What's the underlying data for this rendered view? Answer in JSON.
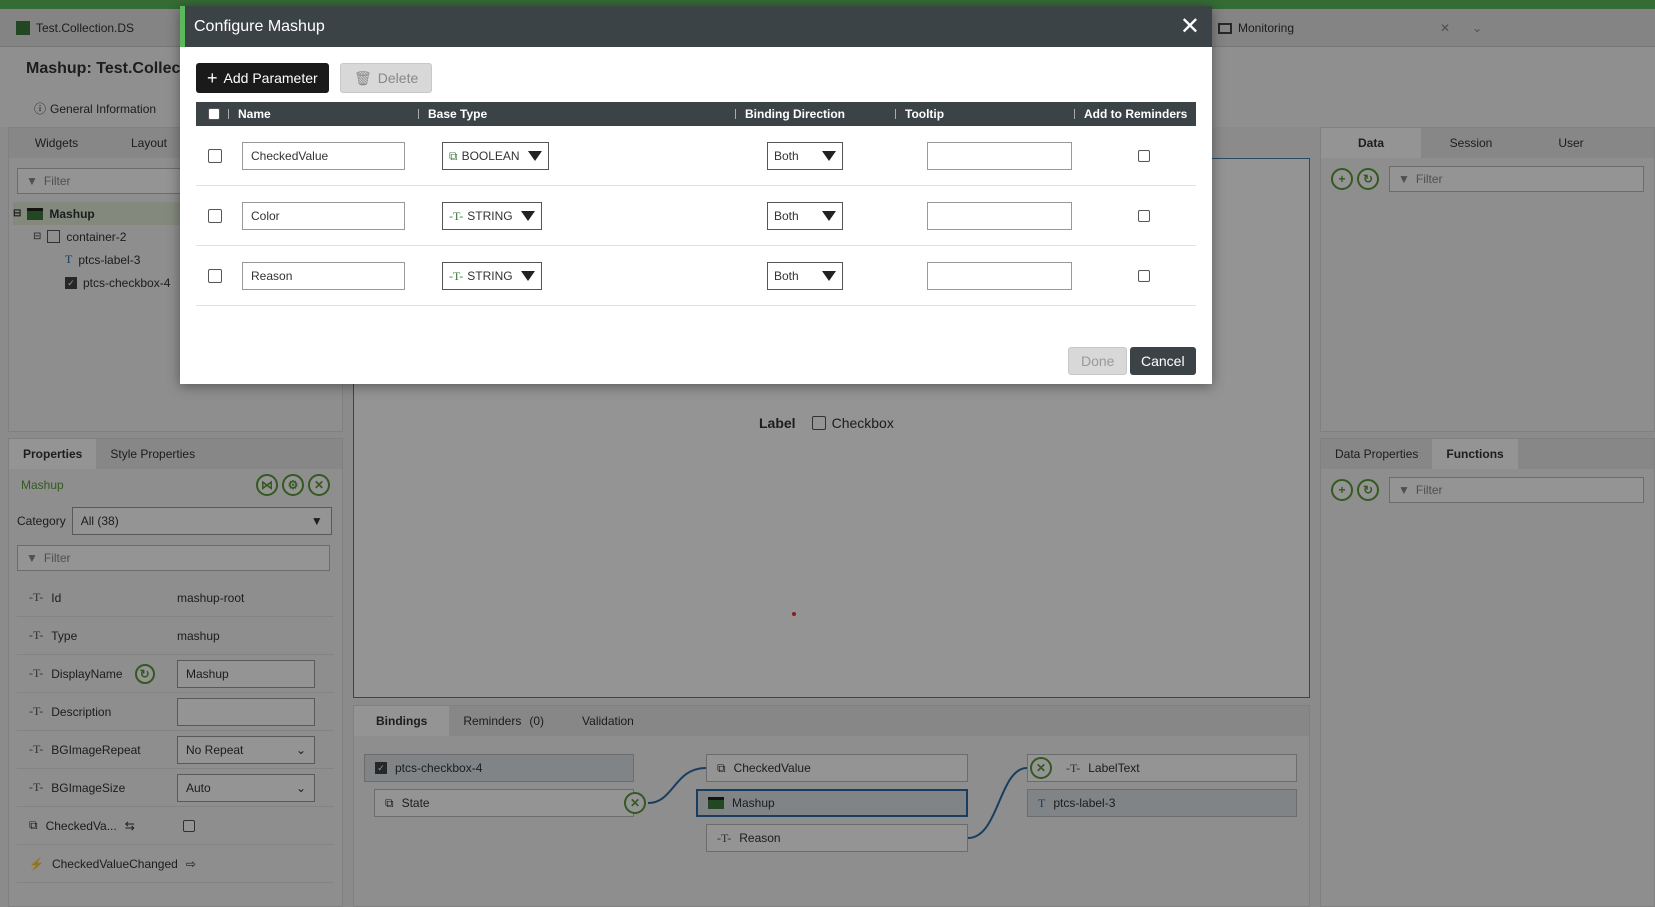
{
  "top_tabs": {
    "left_tab": "Test.Collection.DS",
    "right_tab": "Monitoring"
  },
  "header": {
    "title_prefix": "Mashup:",
    "title_name": "Test.Collect",
    "general_info": "General Information"
  },
  "left_panel": {
    "tabs": [
      "Widgets",
      "Layout"
    ],
    "filter_placeholder": "Filter",
    "tree": [
      {
        "label": "Mashup"
      },
      {
        "label": "container-2"
      },
      {
        "label": "ptcs-label-3"
      },
      {
        "label": "ptcs-checkbox-4"
      }
    ]
  },
  "properties_panel": {
    "tabs": [
      "Properties",
      "Style Properties"
    ],
    "context": "Mashup",
    "category_label": "Category",
    "category_value": "All (38)",
    "filter_placeholder": "Filter",
    "rows": [
      {
        "name": "Id",
        "value": "mashup-root"
      },
      {
        "name": "Type",
        "value": "mashup"
      },
      {
        "name": "DisplayName",
        "value": "Mashup"
      },
      {
        "name": "Description",
        "value": ""
      },
      {
        "name": "BGImageRepeat",
        "value": "No Repeat"
      },
      {
        "name": "BGImageSize",
        "value": "Auto"
      },
      {
        "name": "CheckedVa...",
        "value": ""
      },
      {
        "name": "CheckedValueChanged",
        "value": ""
      }
    ]
  },
  "canvas": {
    "label_text": "Label",
    "checkbox_text": "Checkbox"
  },
  "right_panel": {
    "tabs": [
      "Data",
      "Session",
      "User"
    ],
    "filter_placeholder": "Filter",
    "lower_tabs": [
      "Data Properties",
      "Functions"
    ],
    "lower_filter_placeholder": "Filter"
  },
  "bindings_panel": {
    "tabs": [
      "Bindings",
      "Reminders",
      "Validation"
    ],
    "reminders_count": "(0)",
    "nodes": {
      "checkbox_widget": "ptcs-checkbox-4",
      "state": "State",
      "checked_value": "CheckedValue",
      "mashup": "Mashup",
      "reason": "Reason",
      "label_text": "LabelText",
      "label_widget": "ptcs-label-3"
    }
  },
  "dialog": {
    "title": "Configure Mashup",
    "add_button": "Add Parameter",
    "delete_button": "Delete",
    "columns": [
      "Name",
      "Base Type",
      "Binding Direction",
      "Tooltip",
      "Add to Reminders"
    ],
    "rows": [
      {
        "name": "CheckedValue",
        "base_type": "BOOLEAN",
        "direction": "Both",
        "tooltip": ""
      },
      {
        "name": "Color",
        "base_type": "STRING",
        "direction": "Both",
        "tooltip": ""
      },
      {
        "name": "Reason",
        "base_type": "STRING",
        "direction": "Both",
        "tooltip": ""
      }
    ],
    "done_button": "Done",
    "cancel_button": "Cancel"
  },
  "colors": {
    "accent_green": "#5cb85c",
    "dialog_header": "#3c4347",
    "selection_blue": "#2b6aa3"
  }
}
